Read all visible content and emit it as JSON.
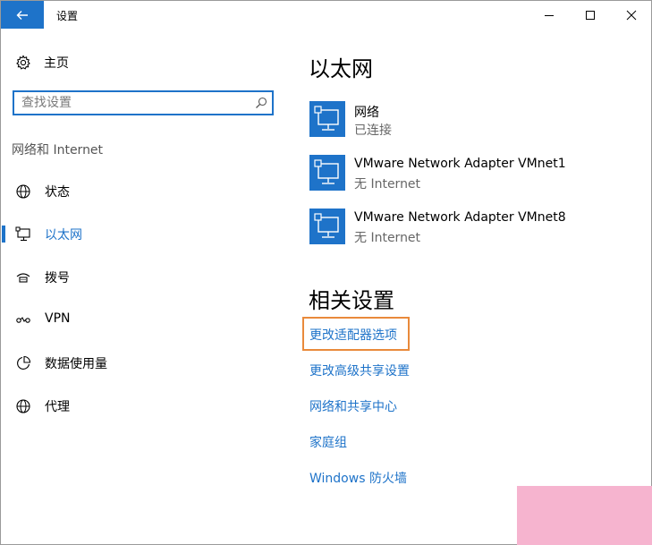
{
  "window": {
    "title": "设置"
  },
  "sidebar": {
    "home_label": "主页",
    "search_placeholder": "查找设置",
    "section_label": "网络和 Internet",
    "items": [
      {
        "label": "状态",
        "icon": "globe-icon"
      },
      {
        "label": "以太网",
        "icon": "ethernet-icon",
        "active": true
      },
      {
        "label": "拨号",
        "icon": "dialup-icon"
      },
      {
        "label": "VPN",
        "icon": "vpn-icon"
      },
      {
        "label": "数据使用量",
        "icon": "data-usage-icon"
      },
      {
        "label": "代理",
        "icon": "globe-icon"
      }
    ]
  },
  "main": {
    "title": "以太网",
    "adapters": [
      {
        "name": "网络",
        "status": "已连接"
      },
      {
        "name": "VMware Network Adapter VMnet1",
        "status": "无 Internet"
      },
      {
        "name": "VMware Network Adapter VMnet8",
        "status": "无 Internet"
      }
    ],
    "related_title": "相关设置",
    "links": [
      "更改适配器选项",
      "更改高级共享设置",
      "网络和共享中心",
      "家庭组",
      "Windows 防火墙"
    ]
  },
  "colors": {
    "accent": "#1e73c9",
    "highlight": "#e98a3b",
    "corner": "#f6b4cf"
  }
}
